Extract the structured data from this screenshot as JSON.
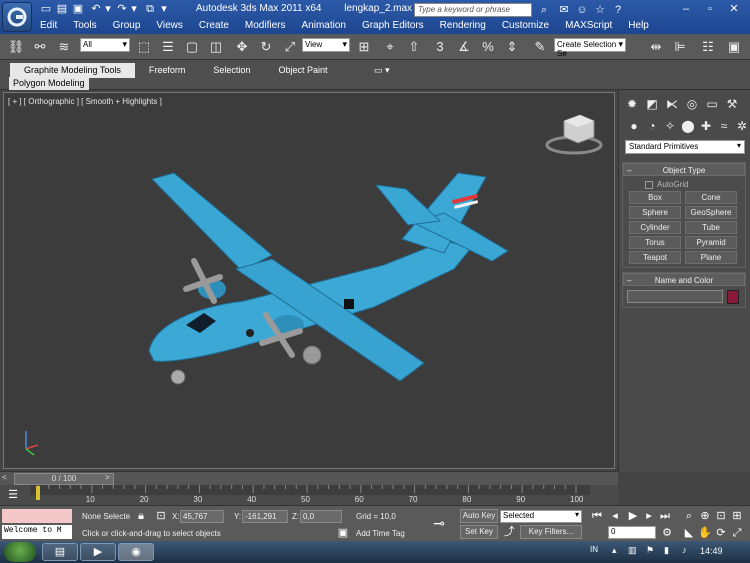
{
  "title": {
    "app": "Autodesk 3ds Max  2011 x64",
    "file": "lengkap_2.max",
    "search_placeholder": "Type a keyword or phrase"
  },
  "menu": [
    "Edit",
    "Tools",
    "Group",
    "Views",
    "Create",
    "Modifiers",
    "Animation",
    "Graph Editors",
    "Rendering",
    "Customize",
    "MAXScript",
    "Help"
  ],
  "toolbar": {
    "filter_value": "All",
    "refcoord_value": "View",
    "selection_set_placeholder": "Create Selection Se"
  },
  "ribbon": {
    "tabs": [
      "Graphite Modeling Tools",
      "Freeform",
      "Selection",
      "Object Paint"
    ],
    "active_tab": "Graphite Modeling Tools",
    "subpanel": "Polygon Modeling"
  },
  "viewport": {
    "label": "[ + ] [ Orthographic ] [ Smooth + Highlights ]"
  },
  "command_panel": {
    "category": "Standard Primitives",
    "object_type_title": "Object Type",
    "autogrid": "AutoGrid",
    "primitives": [
      "Box",
      "Cone",
      "Sphere",
      "GeoSphere",
      "Cylinder",
      "Tube",
      "Torus",
      "Pyramid",
      "Teapot",
      "Plane"
    ],
    "name_color_title": "Name and Color",
    "name_value": "",
    "object_color": "#8a1a3a"
  },
  "timeline": {
    "frame_display": "0 / 100",
    "ticks": [
      "10",
      "20",
      "30",
      "40",
      "50",
      "60",
      "70",
      "80",
      "90",
      "100"
    ],
    "current_frame": "0"
  },
  "status": {
    "maxscript_output": "Welcome to M",
    "selection": "None Selecte",
    "x_label": "X:",
    "x_value": "45,767",
    "y_label": "Y:",
    "y_value": "-161,291",
    "z_label": "Z:",
    "z_value": "0,0",
    "grid": "Grid = 10,0",
    "prompt": "Click or click-and-drag to select objects",
    "add_time_tag": "Add Time Tag",
    "auto_key": "Auto Key",
    "set_key": "Set Key",
    "key_mode": "Selected",
    "key_filters": "Key Filters..."
  },
  "taskbar": {
    "lang": "IN",
    "clock": "14:49"
  },
  "colors": {
    "title_bar": "#2c5aa8",
    "viewport_bg": "#3c3c3c",
    "plane_body": "#3ba8d6",
    "plane_shadow": "#1f6d95"
  }
}
